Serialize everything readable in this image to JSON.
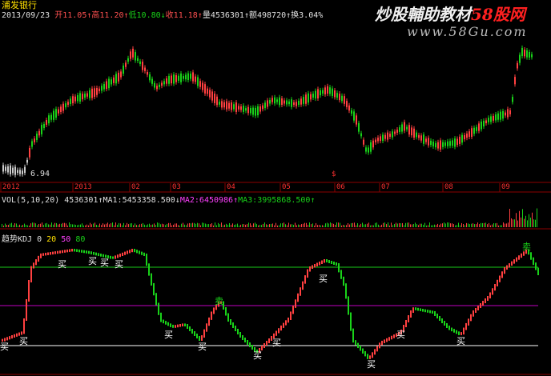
{
  "stock": {
    "name": "浦发银行",
    "date": "2013/09/23",
    "open_label": "开",
    "open": "11.05",
    "high_label": "高",
    "high": "11.20",
    "low_label": "低",
    "low": "10.80",
    "close_label": "收",
    "close": "11.18",
    "vol_label": "量",
    "vol": "4536301",
    "amount_label": "额",
    "amount": "498720",
    "turnover_label": "换",
    "turnover": "3.04%"
  },
  "watermark": {
    "text_a": "炒股輔助教材",
    "text_b": "58股网",
    "url": "www.58Gu.com"
  },
  "price_chart": {
    "min_label": "6.94",
    "x_labels": [
      "2012",
      "2013",
      "02",
      "03",
      "04",
      "05",
      "06",
      "07",
      "08",
      "09"
    ],
    "marker": "$"
  },
  "volume": {
    "header": "VOL(5,10,20)",
    "vol_value": "4536301",
    "ma1_label": "MA1:",
    "ma1": "5453358.500",
    "ma2_label": "MA2:",
    "ma2": "6450986",
    "ma3_label": "MA3:",
    "ma3": "3995868.500"
  },
  "indicator": {
    "name": "趋势KDJ",
    "levels": [
      "0",
      "20",
      "50",
      "80"
    ],
    "buy_label": "买",
    "sell_label": "卖"
  },
  "colors": {
    "up": "#ff4040",
    "down": "#19d219",
    "line80": "#19c819",
    "line50": "#c000c0",
    "line20": "#ffffff",
    "grid": "#8b0000"
  }
}
